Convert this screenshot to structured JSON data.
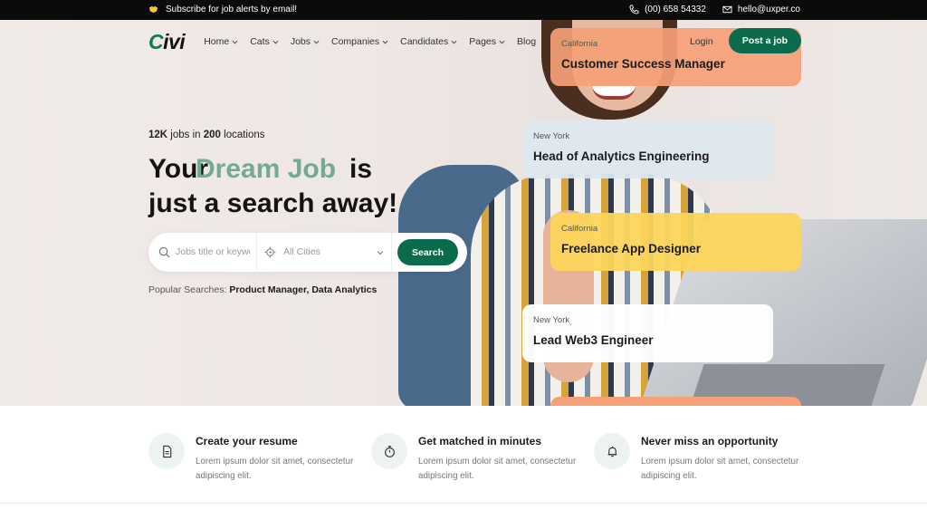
{
  "topbar": {
    "subscribe_text": "Subscribe for job alerts by email!",
    "phone": "(00) 658 54332",
    "email": "hello@uxper.co"
  },
  "nav": {
    "logo_mark": "C",
    "logo_rest": "ivi",
    "items": [
      {
        "label": "Home"
      },
      {
        "label": "Cats"
      },
      {
        "label": "Jobs"
      },
      {
        "label": "Companies"
      },
      {
        "label": "Candidates"
      },
      {
        "label": "Pages"
      },
      {
        "label": "Blog"
      }
    ],
    "login": "Login",
    "post_job": "Post a job"
  },
  "hero": {
    "stats_jobs": "12K",
    "stats_mid": " jobs in ",
    "stats_locations": "200",
    "stats_end": " locations",
    "headline_your": "Your",
    "headline_dream": "Dream Job",
    "headline_is": "is",
    "headline_line2": "just a search away!",
    "search": {
      "keyword_placeholder": "Jobs title or keywords",
      "city_placeholder": "All Cities",
      "button": "Search"
    },
    "popular_label": "Popular Searches: ",
    "popular_tags": [
      "Product Manager,",
      "Data Analytics"
    ]
  },
  "job_cards": [
    {
      "location": "California",
      "title": "Customer Success Manager",
      "color": "#f5a076"
    },
    {
      "location": "New York",
      "title": "Head of Analytics Engineering",
      "color": "#dee7f0"
    },
    {
      "location": "California",
      "title": "Freelance App Designer",
      "color": "#fcd55b"
    },
    {
      "location": "New York",
      "title": "Lead Web3 Engineer",
      "color": "#ffffff"
    }
  ],
  "features": [
    {
      "title": "Create your resume",
      "desc": "Lorem ipsum dolor sit amet, consectetur adipiscing elit.",
      "icon": "document-icon"
    },
    {
      "title": "Get matched in minutes",
      "desc": "Lorem ipsum dolor sit amet, consectetur adipiscing elit.",
      "icon": "stopwatch-icon"
    },
    {
      "title": "Never miss an opportunity",
      "desc": "Lorem ipsum dolor sit amet, consectetur adipiscing elit.",
      "icon": "bell-icon"
    }
  ],
  "colors": {
    "brand_green": "#0c6b4c",
    "headline_accent": "#74aa93"
  }
}
